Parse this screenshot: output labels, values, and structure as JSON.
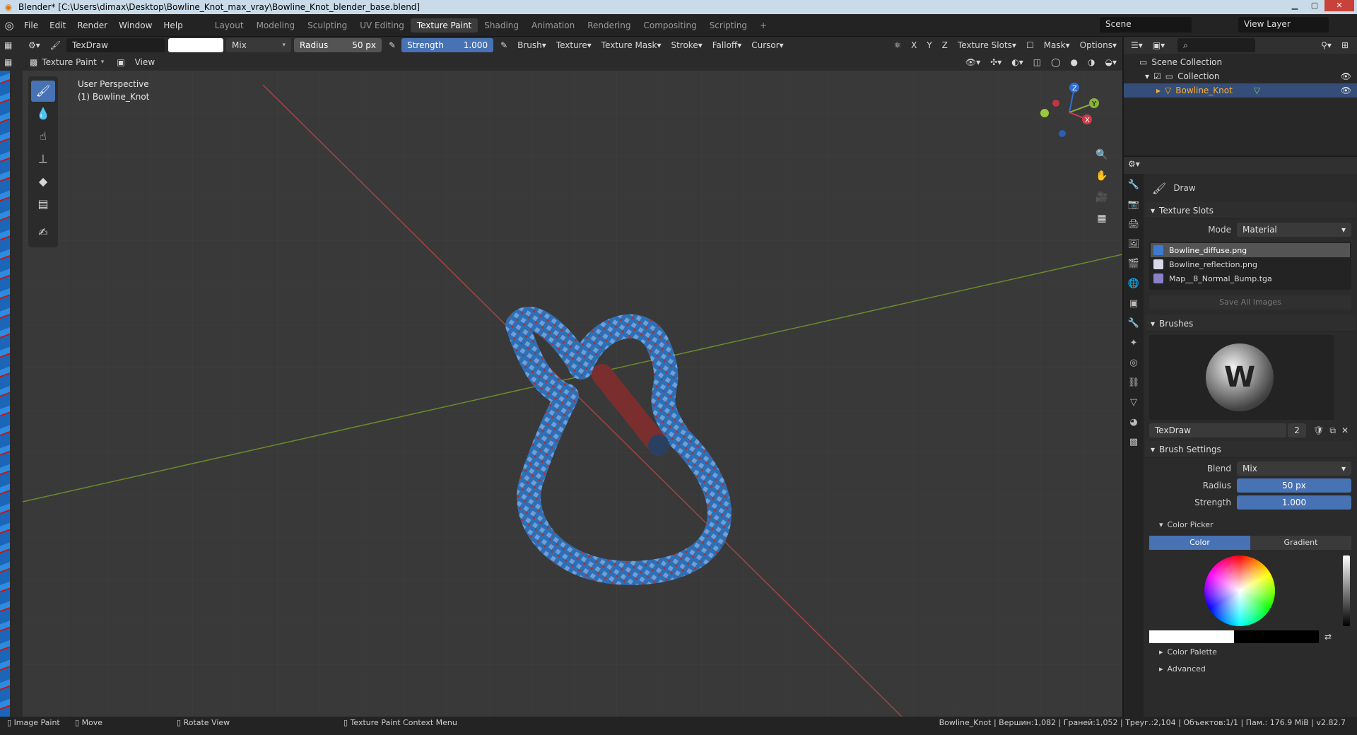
{
  "window": {
    "title": "Blender* [C:\\Users\\dimax\\Desktop\\Bowline_Knot_max_vray\\Bowline_Knot_blender_base.blend]"
  },
  "menu": {
    "items": [
      "File",
      "Edit",
      "Render",
      "Window",
      "Help"
    ]
  },
  "workspaces": [
    "Layout",
    "Modeling",
    "Sculpting",
    "UV Editing",
    "Texture Paint",
    "Shading",
    "Animation",
    "Rendering",
    "Compositing",
    "Scripting"
  ],
  "active_workspace": "Texture Paint",
  "scene": "Scene",
  "view_layer": "View Layer",
  "tool_header": {
    "brush_name": "TexDraw",
    "blend": "Mix",
    "radius_label": "Radius",
    "radius_value": "50 px",
    "strength_label": "Strength",
    "strength_value": "1.000",
    "menus": [
      "Brush",
      "Texture",
      "Texture Mask",
      "Stroke",
      "Falloff",
      "Cursor"
    ],
    "axes": [
      "X",
      "Y",
      "Z"
    ],
    "texture_slots": "Texture Slots",
    "mask": "Mask",
    "options": "Options"
  },
  "viewport_header": {
    "mode": "Texture Paint",
    "view": "View"
  },
  "viewport": {
    "perspective": "User Perspective",
    "object": "(1) Bowline_Knot"
  },
  "gizmo": {
    "z": "Z",
    "y": "Y",
    "x": "X"
  },
  "outliner": {
    "scene_collection": "Scene Collection",
    "collection": "Collection",
    "object": "Bowline_Knot"
  },
  "properties": {
    "tool": "Draw",
    "texture_slots": {
      "title": "Texture Slots",
      "mode_label": "Mode",
      "mode_value": "Material",
      "slots": [
        "Bowline_diffuse.png",
        "Bowline_reflection.png",
        "Map__8_Normal_Bump.tga"
      ],
      "save_all": "Save All Images"
    },
    "brushes": {
      "title": "Brushes",
      "brush_name": "TexDraw",
      "users": "2"
    },
    "brush_settings": {
      "title": "Brush Settings",
      "blend_label": "Blend",
      "blend_value": "Mix",
      "radius_label": "Radius",
      "radius_value": "50 px",
      "strength_label": "Strength",
      "strength_value": "1.000"
    },
    "color_picker": {
      "title": "Color Picker",
      "tab_color": "Color",
      "tab_gradient": "Gradient"
    },
    "color_palette": "Color Palette",
    "advanced": "Advanced"
  },
  "statusbar": {
    "image_paint": "Image Paint",
    "move": "Move",
    "rotate": "Rotate View",
    "context": "Texture Paint Context Menu",
    "stats": "Bowline_Knot | Вершин:1,082 | Граней:1,052 | Треуг.:2,104 | Объектов:1/1 | Пам.: 176.9 MiB | v2.82.7"
  }
}
